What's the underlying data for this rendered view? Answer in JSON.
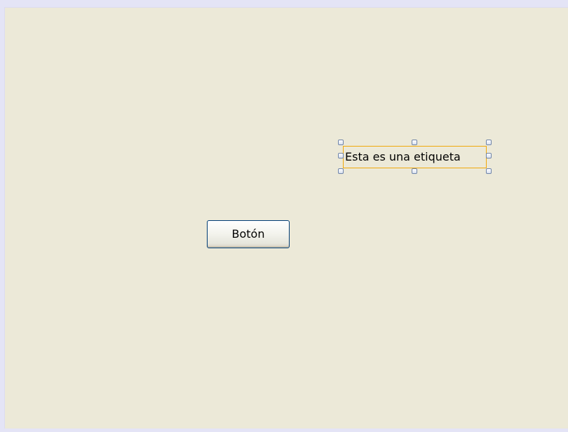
{
  "designer": {
    "button": {
      "label": "Botón"
    },
    "label": {
      "text": "Esta es una etiqueta",
      "selected": true,
      "selection_color": "#f0a80a"
    },
    "form_background": "#ece9d8",
    "window_background": "#e4e4f6"
  }
}
